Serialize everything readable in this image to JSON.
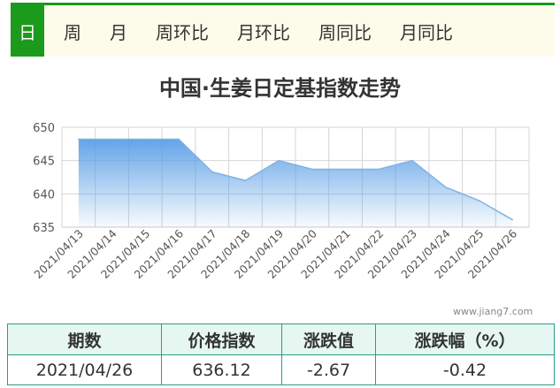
{
  "tabs": [
    {
      "label": "日",
      "active": true
    },
    {
      "label": "周",
      "active": false
    },
    {
      "label": "月",
      "active": false
    },
    {
      "label": "周环比",
      "active": false
    },
    {
      "label": "月环比",
      "active": false
    },
    {
      "label": "周同比",
      "active": false
    },
    {
      "label": "月同比",
      "active": false
    }
  ],
  "watermark": "www.jiang7.com",
  "colors": {
    "accent": "#1b9a1b",
    "line": "#7eb3e6",
    "area_top": "#5b9fe6",
    "table_border": "#2e9b86"
  },
  "chart_data": {
    "type": "area",
    "title": "中国·生姜日定基指数走势",
    "xlabel": "",
    "ylabel": "",
    "ylim": [
      635,
      650
    ],
    "yticks": [
      635,
      640,
      645,
      650
    ],
    "grid": true,
    "categories": [
      "2021/04/13",
      "2021/04/14",
      "2021/04/15",
      "2021/04/16",
      "2021/04/17",
      "2021/04/18",
      "2021/04/19",
      "2021/04/20",
      "2021/04/21",
      "2021/04/22",
      "2021/04/23",
      "2021/04/24",
      "2021/04/25",
      "2021/04/26"
    ],
    "values": [
      648.2,
      648.2,
      648.2,
      648.2,
      643.3,
      642.0,
      645.0,
      643.7,
      643.7,
      643.7,
      645.0,
      641.0,
      639.0,
      636.12
    ]
  },
  "table": {
    "headers": [
      "期数",
      "价格指数",
      "涨跌值",
      "涨跌幅（%）"
    ],
    "rows": [
      [
        "2021/04/26",
        "636.12",
        "-2.67",
        "-0.42"
      ]
    ]
  }
}
